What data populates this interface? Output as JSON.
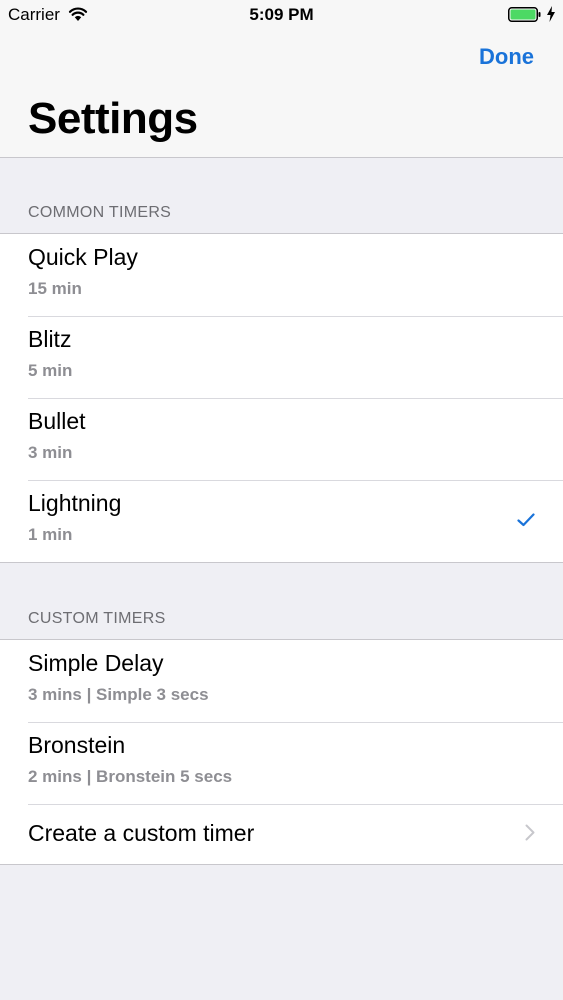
{
  "status_bar": {
    "carrier": "Carrier",
    "time": "5:09 PM",
    "battery_color": "#4cd964"
  },
  "nav": {
    "done_label": "Done",
    "title": "Settings"
  },
  "colors": {
    "accent": "#1a73d9",
    "background": "#efeff4"
  },
  "sections": [
    {
      "header": "COMMON TIMERS",
      "items": [
        {
          "title": "Quick Play",
          "subtitle": "15 min",
          "selected": false
        },
        {
          "title": "Blitz",
          "subtitle": "5 min",
          "selected": false
        },
        {
          "title": "Bullet",
          "subtitle": "3 min",
          "selected": false
        },
        {
          "title": "Lightning",
          "subtitle": "1 min",
          "selected": true
        }
      ]
    },
    {
      "header": "CUSTOM TIMERS",
      "items": [
        {
          "title": "Simple Delay",
          "subtitle": "3 mins | Simple 3 secs"
        },
        {
          "title": "Bronstein",
          "subtitle": "2 mins | Bronstein 5 secs"
        },
        {
          "title": "Create a custom timer",
          "icon": "chevron-right-icon"
        }
      ]
    }
  ]
}
